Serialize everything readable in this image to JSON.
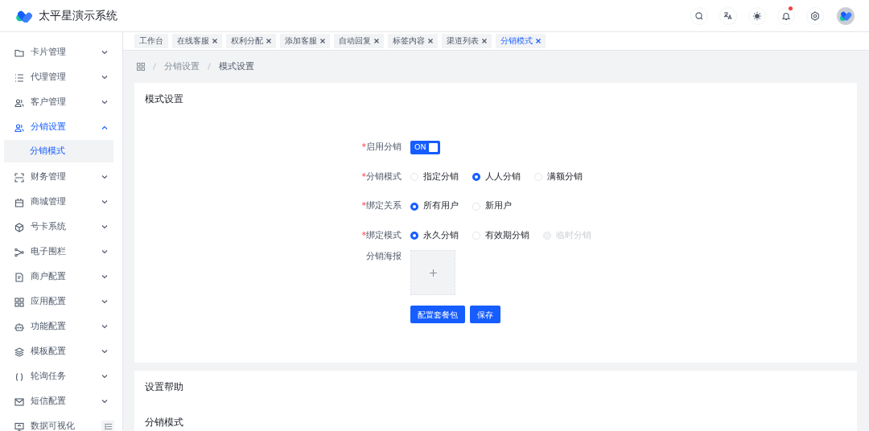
{
  "app": {
    "title": "太平星演示系统"
  },
  "sidebar": {
    "items": [
      {
        "label": "卡片管理",
        "expanded": false
      },
      {
        "label": "代理管理",
        "expanded": false
      },
      {
        "label": "客户管理",
        "expanded": false
      },
      {
        "label": "分销设置",
        "expanded": true,
        "children": [
          {
            "label": "分销模式",
            "selected": true
          }
        ]
      },
      {
        "label": "财务管理",
        "expanded": false
      },
      {
        "label": "商城管理",
        "expanded": false
      },
      {
        "label": "号卡系统",
        "expanded": false
      },
      {
        "label": "电子围栏",
        "expanded": false
      },
      {
        "label": "商户配置",
        "expanded": false
      },
      {
        "label": "应用配置",
        "expanded": false
      },
      {
        "label": "功能配置",
        "expanded": false
      },
      {
        "label": "模板配置",
        "expanded": false
      },
      {
        "label": "轮询任务",
        "expanded": false
      },
      {
        "label": "短信配置",
        "expanded": false
      },
      {
        "label": "数据可视化",
        "expanded": false
      }
    ]
  },
  "tabs": [
    {
      "label": "工作台",
      "closable": false,
      "selected": false
    },
    {
      "label": "在线客服",
      "closable": true,
      "selected": false
    },
    {
      "label": "权利分配",
      "closable": true,
      "selected": false
    },
    {
      "label": "添加客服",
      "closable": true,
      "selected": false
    },
    {
      "label": "自动回复",
      "closable": true,
      "selected": false
    },
    {
      "label": "标签内容",
      "closable": true,
      "selected": false
    },
    {
      "label": "渠道列表",
      "closable": true,
      "selected": false
    },
    {
      "label": "分销模式",
      "closable": true,
      "selected": true
    }
  ],
  "breadcrumb": [
    "分销设置",
    "模式设置"
  ],
  "form": {
    "title": "模式设置",
    "rows": [
      {
        "kind": "switch",
        "label": "启用分销",
        "required_mark": "*",
        "on": true,
        "text": "ON"
      },
      {
        "kind": "radio",
        "label": "分销模式",
        "required_mark": "*",
        "options": [
          {
            "label": "指定分销",
            "selected": false,
            "disabled": false
          },
          {
            "label": "人人分销",
            "selected": true,
            "disabled": false
          },
          {
            "label": "满额分销",
            "selected": false,
            "disabled": false
          }
        ]
      },
      {
        "kind": "radio",
        "label": "绑定关系",
        "required_mark": "*",
        "options": [
          {
            "label": "所有用户",
            "selected": true,
            "disabled": false
          },
          {
            "label": "新用户",
            "selected": false,
            "disabled": false
          }
        ]
      },
      {
        "kind": "radio",
        "label": "绑定模式",
        "required_mark": "*",
        "options": [
          {
            "label": "永久分销",
            "selected": true,
            "disabled": false
          },
          {
            "label": "有效期分销",
            "selected": false,
            "disabled": false
          },
          {
            "label": "临时分销",
            "selected": false,
            "disabled": true
          }
        ]
      },
      {
        "kind": "upload",
        "label": "分销海报"
      }
    ],
    "buttons": [
      "配置套餐包",
      "保存"
    ]
  },
  "help": {
    "title": "设置帮助",
    "section": "分销模式"
  }
}
